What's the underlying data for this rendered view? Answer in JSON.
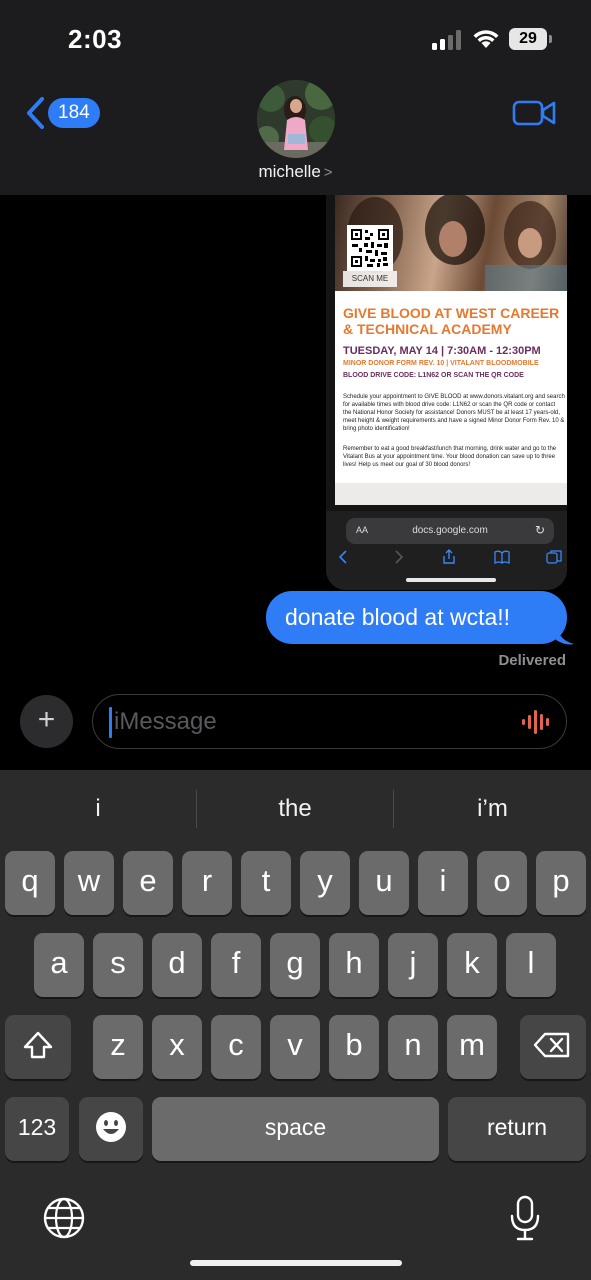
{
  "status_bar": {
    "time": "2:03",
    "battery": "29"
  },
  "header": {
    "back_count": "184",
    "contact_name": "michelle",
    "contact_chevron": ">"
  },
  "conversation": {
    "flyer": {
      "scan_label": "SCAN ME",
      "title": "GIVE BLOOD AT WEST CAREER & TECHNICAL ACADEMY",
      "date_line": "TUESDAY, MAY 14 | 7:30AM - 12:30PM",
      "sub_line_1": "MINOR DONOR FORM REV. 10 | VITALANT BLOODMOBILE",
      "sub_line_2": "BLOOD DRIVE CODE: L1N62 OR SCAN THE QR CODE",
      "body_1": "Schedule your appointment to GIVE BLOOD at www.donors.vitalant.org and search for available times with blood drive code: L1N62 or scan the QR code or contact the National Honor Society for assistance! Donors MUST be at least 17 years-old, meet height & weight requirements and have a signed Minor Donor Form Rev. 10 & bring photo identification!",
      "body_2": "Remember to eat a good breakfast/lunch that morning, drink water and go to the Vitalant Bus at your appointment time. Your blood donation can save up to three lives! Help us meet our goal of 30 blood donors!"
    },
    "browser": {
      "aa_label": "AA",
      "url": "docs.google.com"
    },
    "message_text": "donate blood at wcta!!",
    "delivery_status": "Delivered"
  },
  "compose": {
    "plus_label": "+",
    "placeholder": "iMessage"
  },
  "keyboard": {
    "suggestions": [
      "i",
      "the",
      "i’m"
    ],
    "row1": [
      "q",
      "w",
      "e",
      "r",
      "t",
      "y",
      "u",
      "i",
      "o",
      "p"
    ],
    "row2": [
      "a",
      "s",
      "d",
      "f",
      "g",
      "h",
      "j",
      "k",
      "l"
    ],
    "row3": [
      "z",
      "x",
      "c",
      "v",
      "b",
      "n",
      "m"
    ],
    "numbers_label": "123",
    "space_label": "space",
    "return_label": "return"
  },
  "colors": {
    "accent": "#2f7df6",
    "header_bg": "#1c1c1e",
    "keyboard_bg": "#2b2b2b",
    "key_bg": "#6b6b6b",
    "audio_icon": "#e2664b"
  }
}
